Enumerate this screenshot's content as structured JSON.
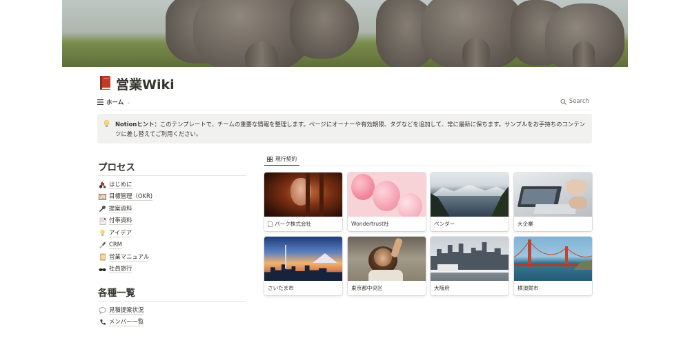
{
  "page": {
    "title": "営業Wiki",
    "icon": "red-book-icon"
  },
  "viewbar": {
    "view_label": "ホーム",
    "view_icon": "list-icon",
    "search_label": "Search"
  },
  "callout": {
    "icon": "lightbulb-icon",
    "bold": "Notionヒント：",
    "text": "このテンプレートで、チームの重要な情報を整理します。ページにオーナーや有効期限、タグなどを追加して、常に最新に保ちます。サンプルをお手持ちのコンテンツに差し替えてご利用ください。"
  },
  "sections": [
    {
      "title": "プロセス",
      "items": [
        {
          "icon": "tractor-icon",
          "label": "はじめに"
        },
        {
          "icon": "abacus-icon",
          "label": "目標管理（OKR)"
        },
        {
          "icon": "microphone-icon",
          "label": "提案資料"
        },
        {
          "icon": "bookmark-tabs-icon",
          "label": "付帯資料"
        },
        {
          "icon": "lightbulb-icon",
          "label": "アイデア"
        },
        {
          "icon": "screwdriver-icon",
          "label": "CRM"
        },
        {
          "icon": "scroll-icon",
          "label": "営業マニュアル"
        },
        {
          "icon": "sunglasses-icon",
          "label": "社員旅行"
        }
      ]
    },
    {
      "title": "各種一覧",
      "items": [
        {
          "icon": "speech-bubble-icon",
          "label": "見積提案状況"
        },
        {
          "icon": "telephone-icon",
          "label": "メンバー一覧"
        }
      ]
    }
  ],
  "gallery": {
    "tab_label": "現行契約",
    "tab_icon": "gallery-grid-icon",
    "cards": [
      {
        "label": "パーク株式会社",
        "icon": "page-icon",
        "image": "pig-in-dark-stall"
      },
      {
        "label": "Wondertrust社",
        "image": "pink-balloons"
      },
      {
        "label": "ベンダー",
        "image": "snowy-fjord"
      },
      {
        "label": "大企業",
        "image": "laptop-meeting"
      },
      {
        "label": "さいたま市",
        "image": "city-skyline-mountain"
      },
      {
        "label": "東京都中央区",
        "image": "woman-raising-hand"
      },
      {
        "label": "大阪府",
        "image": "harbor-city-skyline"
      },
      {
        "label": "横須賀市",
        "image": "golden-gate-bridge"
      }
    ]
  },
  "colors": {
    "text": "#37352f",
    "callout_bg": "#f1f1ef",
    "divider": "#ececea",
    "muted": "#9b9a97"
  }
}
